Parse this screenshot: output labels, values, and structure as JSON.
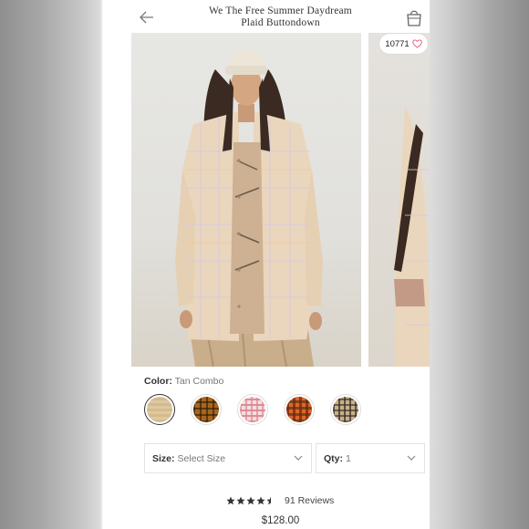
{
  "header": {
    "title_line1": "We The Free Summer Daydream",
    "title_line2": "Plaid Buttondown"
  },
  "gallery": {
    "like_count": "10771"
  },
  "color": {
    "label": "Color:",
    "value": "Tan Combo",
    "swatches": [
      {
        "name": "Tan Combo",
        "selected": true
      },
      {
        "name": "brown plaid",
        "selected": false
      },
      {
        "name": "pink plaid",
        "selected": false
      },
      {
        "name": "orange plaid",
        "selected": false
      },
      {
        "name": "grey plaid",
        "selected": false
      }
    ]
  },
  "size": {
    "label": "Size:",
    "value": "Select Size"
  },
  "qty": {
    "label": "Qty:",
    "value": "1"
  },
  "rating": {
    "stars": 4.5,
    "reviews": "91 Reviews"
  },
  "price": "$128.00",
  "colors": {
    "accent_heart": "#e05a6d",
    "text": "#333333"
  }
}
